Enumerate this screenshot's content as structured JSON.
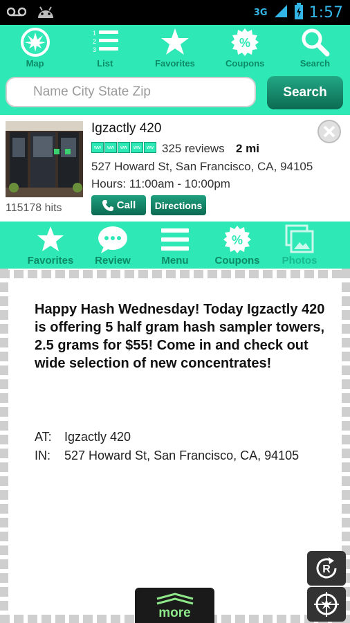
{
  "status_bar": {
    "network": "3G",
    "time": "1:57"
  },
  "top_nav": [
    {
      "label": "Map",
      "icon": "leaf-map-icon"
    },
    {
      "label": "List",
      "icon": "numbered-list-icon"
    },
    {
      "label": "Favorites",
      "icon": "star-icon"
    },
    {
      "label": "Coupons",
      "icon": "percent-badge-icon"
    },
    {
      "label": "Search",
      "icon": "magnifier-icon"
    }
  ],
  "search": {
    "placeholder": "Name City State Zip",
    "button_label": "Search"
  },
  "listing": {
    "name": "Igzactly 420",
    "reviews": "325 reviews",
    "distance": "2 mi",
    "address": "527 Howard St, San Francisco, CA, 94105",
    "hours": "Hours: 11:00am - 10:00pm",
    "hits": "115178 hits",
    "call_label": "Call",
    "directions_label": "Directions",
    "rating_leaves": 5
  },
  "bottom_nav": [
    {
      "label": "Favorites",
      "icon": "star-icon"
    },
    {
      "label": "Review",
      "icon": "chat-bubble-icon"
    },
    {
      "label": "Menu",
      "icon": "hamburger-icon"
    },
    {
      "label": "Coupons",
      "icon": "percent-badge-icon"
    },
    {
      "label": "Photos",
      "icon": "photos-icon"
    }
  ],
  "coupon": {
    "text": "Happy Hash Wednesday!  Today Igzactly 420 is offering 5 half gram hash sampler towers, 2.5 grams for $55!  Come in and check out wide selection of new concentrates!",
    "at_label": "AT:",
    "at_value": "Igzactly 420",
    "in_label": "IN:",
    "in_value": "527 Howard St, San Francisco, CA, 94105",
    "more_label": "more"
  },
  "colors": {
    "accent": "#2ee8b6",
    "dark_green": "#0c6a52",
    "label_green": "#0d8a66"
  }
}
